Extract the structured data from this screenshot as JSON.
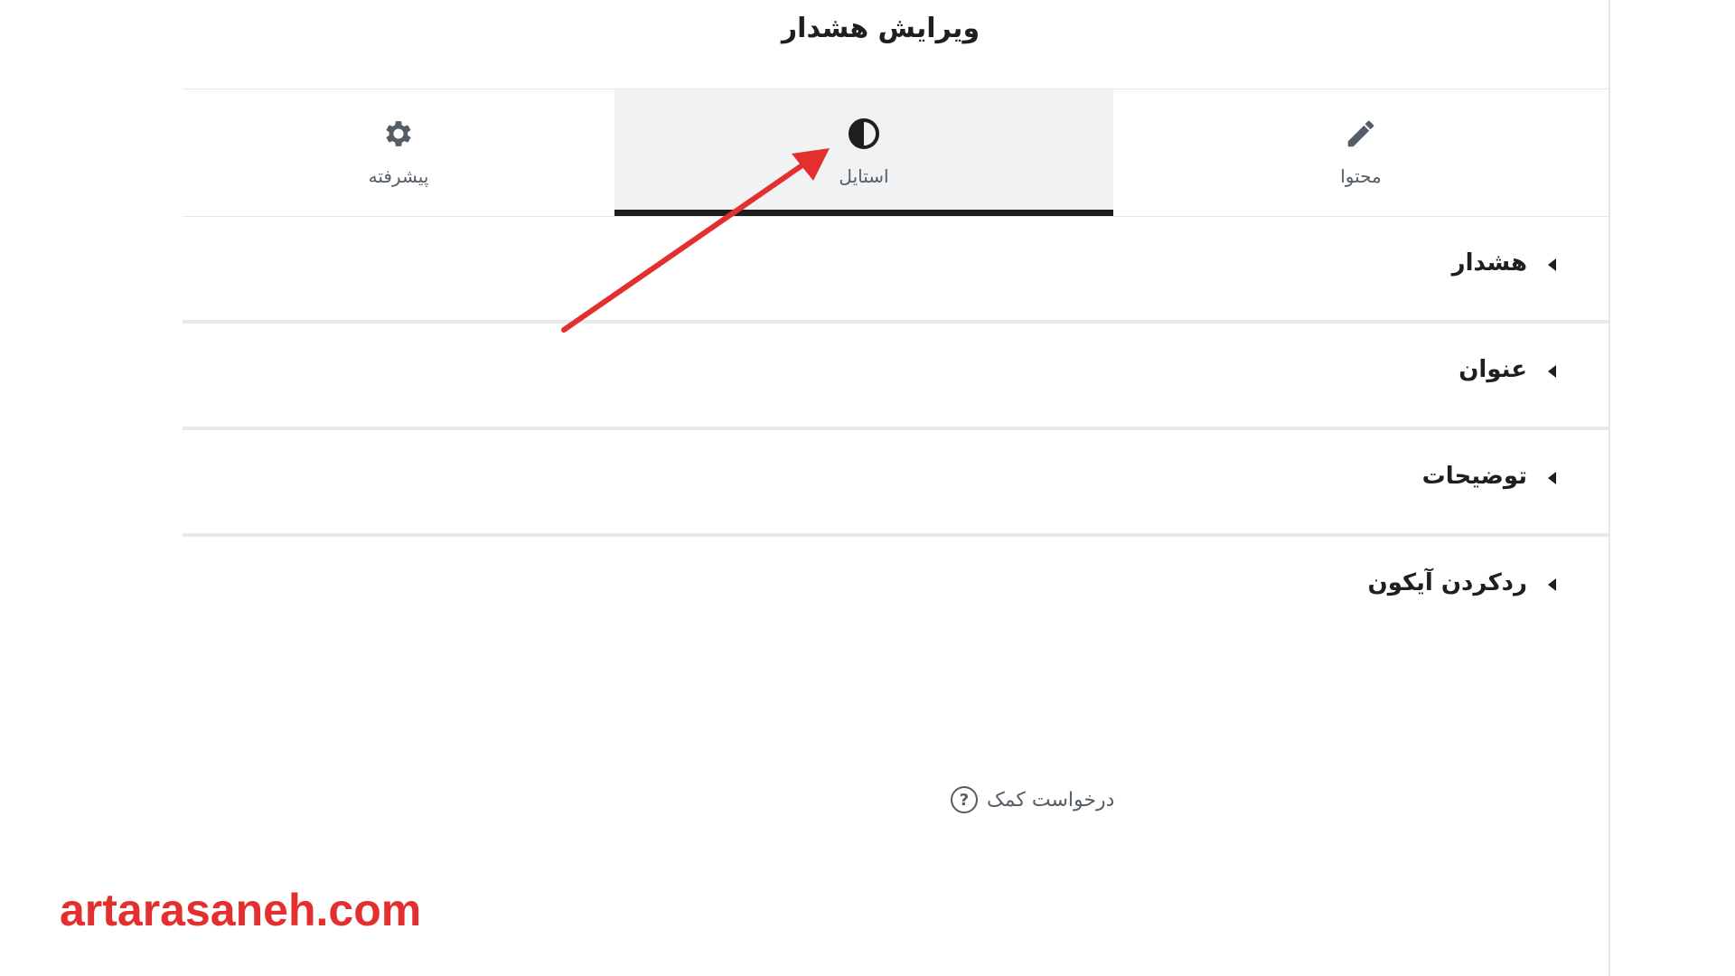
{
  "panel": {
    "title": "ویرایش هشدار"
  },
  "tabs": [
    {
      "label": "پیشرفته",
      "icon": "gear-icon"
    },
    {
      "label": "استایل",
      "icon": "contrast-icon",
      "active": true
    },
    {
      "label": "محتوا",
      "icon": "pencil-icon"
    }
  ],
  "sections": [
    {
      "label": "هشدار"
    },
    {
      "label": "عنوان"
    },
    {
      "label": "توضیحات"
    },
    {
      "label": "ردکردن آیکون"
    }
  ],
  "help": {
    "label": "درخواست کمک",
    "icon_glyph": "?"
  },
  "watermark": "artarasaneh.com",
  "colors": {
    "accent_arrow": "#e3302f",
    "active_tab_bg": "#f1f2f3",
    "active_tab_underline": "#1e1e1e"
  }
}
